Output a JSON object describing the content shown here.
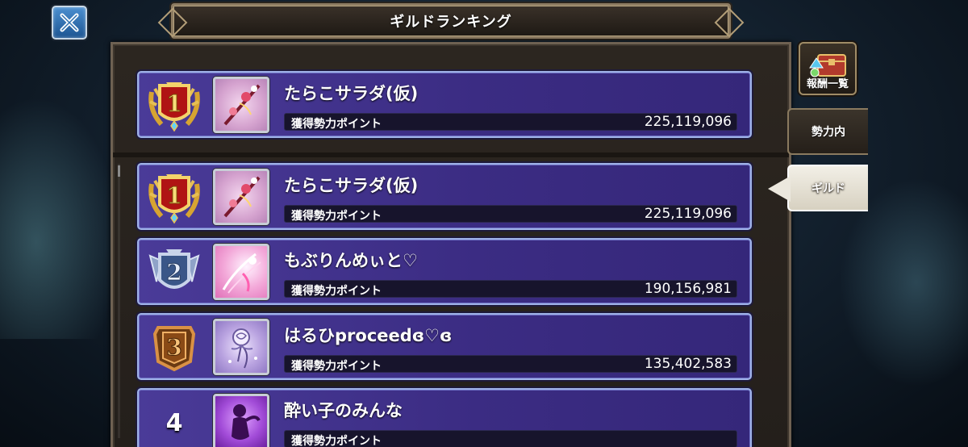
{
  "header": {
    "title": "ギルドランキング"
  },
  "side": {
    "reward_label": "報酬一覧",
    "tab_faction": "勢力内",
    "tab_guild": "ギルド",
    "active_tab": "ギルド"
  },
  "my_guild": {
    "rank": 1,
    "name": "たらこサラダ(仮)",
    "points_label": "獲得勢力ポイント",
    "points": "225,119,096"
  },
  "ranking": [
    {
      "rank": 1,
      "name": "たらこサラダ(仮)",
      "points_label": "獲得勢力ポイント",
      "points": "225,119,096"
    },
    {
      "rank": 2,
      "name": "もぶりんめぃと♡",
      "points_label": "獲得勢力ポイント",
      "points": "190,156,981"
    },
    {
      "rank": 3,
      "name": "はるひproceedɞ♡ɞ",
      "points_label": "獲得勢力ポイント",
      "points": "135,402,583"
    },
    {
      "rank": 4,
      "rank_text": "4",
      "name": "酔い子のみんな",
      "points_label": "獲得勢力ポイント",
      "points": ""
    }
  ],
  "colors": {
    "row_fill": "#3b2c83",
    "row_border": "#9fb2e8",
    "gold": "#e0b13a",
    "silver": "#9fb0cf",
    "bronze": "#c07a2c"
  }
}
